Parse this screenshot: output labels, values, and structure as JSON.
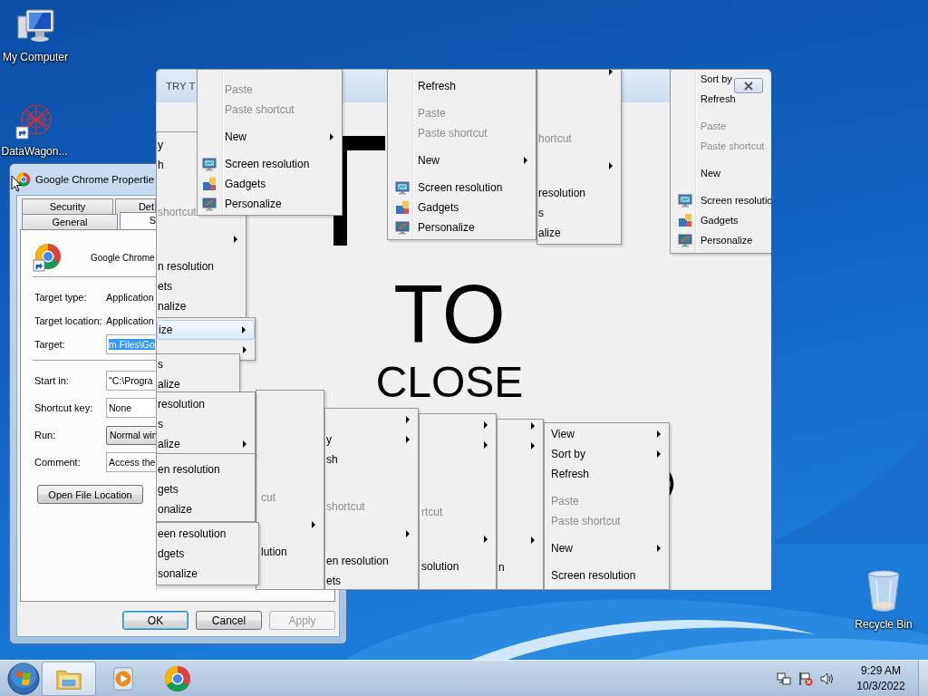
{
  "desktop_icons": [
    {
      "kind": "computer",
      "label": "My Computer"
    },
    {
      "kind": "shortcut",
      "label": "DataWagon..."
    },
    {
      "kind": "bin",
      "label": "Recycle Bin"
    }
  ],
  "properties_dialog": {
    "title": "Google Chrome Propertie",
    "tab_rows": [
      [
        {
          "label": "Security",
          "selected": false
        },
        {
          "label": "Det",
          "selected": false
        }
      ],
      [
        {
          "label": "General",
          "selected": false
        },
        {
          "label": "S",
          "selected": true
        }
      ]
    ],
    "app_name": "Google Chrome",
    "field_groups": [
      [
        {
          "kind": "info",
          "label": "Target type:",
          "value": "Application"
        },
        {
          "kind": "info",
          "label": "Target location:",
          "value": "Application"
        },
        {
          "kind": "input",
          "label": "Target:",
          "value": "m Files\\Go",
          "text_selected": true
        }
      ],
      [
        {
          "kind": "input",
          "label": "Start in:",
          "value": "\"C:\\Progra",
          "text_selected": false
        },
        {
          "kind": "input",
          "label": "Shortcut key:",
          "value": "None",
          "text_selected": false
        },
        {
          "kind": "dropdown",
          "label": "Run:",
          "value": "Normal win"
        },
        {
          "kind": "input",
          "label": "Comment:",
          "value": "Access the",
          "text_selected": false
        }
      ]
    ],
    "action_button": "Open File Location",
    "buttons": [
      {
        "label": "OK",
        "default": true,
        "disabled": false
      },
      {
        "label": "Cancel",
        "default": false,
        "disabled": false
      },
      {
        "label": "Apply",
        "default": false,
        "disabled": true
      }
    ]
  },
  "prank_window": {
    "title": "TRY T",
    "lines": [
      "TO",
      "CLOSE"
    ],
    "menus": [
      {
        "rows": [
          {
            "kind": "item",
            "text": "y",
            "disabled": false,
            "submenu": false
          },
          {
            "kind": "item",
            "text": "h",
            "disabled": false,
            "submenu": false
          },
          {
            "kind": "separator"
          },
          {
            "kind": "blank"
          },
          {
            "kind": "item",
            "text": "shortcut",
            "disabled": true,
            "submenu": false
          },
          {
            "kind": "separator"
          },
          {
            "kind": "item",
            "disabled": false,
            "submenu": true
          },
          {
            "kind": "separator"
          },
          {
            "kind": "item",
            "text": "n resolution",
            "disabled": false,
            "submenu": false
          },
          {
            "kind": "item",
            "text": "ets",
            "disabled": false,
            "submenu": false
          },
          {
            "kind": "item",
            "text": "nalize",
            "disabled": false,
            "submenu": false
          }
        ]
      },
      {
        "rows": [
          {
            "kind": "item",
            "text": "Paste",
            "disabled": true,
            "submenu": false
          },
          {
            "kind": "item",
            "text": "Paste shortcut",
            "disabled": true,
            "submenu": false
          },
          {
            "kind": "separator"
          },
          {
            "kind": "item",
            "text": "New",
            "disabled": false,
            "submenu": true
          },
          {
            "kind": "separator"
          },
          {
            "kind": "icon-item",
            "text": "Screen resolution",
            "disabled": false,
            "submenu": false
          },
          {
            "kind": "icon-item",
            "text": "Gadgets",
            "disabled": false,
            "submenu": false
          },
          {
            "kind": "icon-item",
            "text": "Personalize",
            "disabled": false,
            "submenu": false
          }
        ]
      },
      {
        "rows": [
          {
            "kind": "item",
            "disabled": false,
            "submenu": true
          },
          {
            "kind": "blank"
          },
          {
            "kind": "separator"
          },
          {
            "kind": "blank"
          },
          {
            "kind": "item",
            "text": "hortcut",
            "disabled": true,
            "submenu": false
          },
          {
            "kind": "separator"
          },
          {
            "kind": "item",
            "disabled": false,
            "submenu": true
          },
          {
            "kind": "separator"
          },
          {
            "kind": "item",
            "text": "resolution",
            "disabled": false,
            "submenu": false
          },
          {
            "kind": "item",
            "text": "s",
            "disabled": false,
            "submenu": false
          },
          {
            "kind": "item",
            "text": "alize",
            "disabled": false,
            "submenu": false
          }
        ]
      },
      {
        "rows": [
          {
            "kind": "item",
            "text": "Refresh",
            "disabled": false,
            "submenu": false
          },
          {
            "kind": "separator"
          },
          {
            "kind": "item",
            "text": "Paste",
            "disabled": true,
            "submenu": false
          },
          {
            "kind": "item",
            "text": "Paste shortcut",
            "disabled": true,
            "submenu": false
          },
          {
            "kind": "separator"
          },
          {
            "kind": "item",
            "text": "New",
            "disabled": false,
            "submenu": true
          },
          {
            "kind": "separator"
          },
          {
            "kind": "icon-item",
            "text": "Screen resolution",
            "disabled": false,
            "submenu": false
          },
          {
            "kind": "icon-item",
            "text": "Gadgets",
            "disabled": false,
            "submenu": false
          },
          {
            "kind": "icon-item",
            "text": "Personalize",
            "disabled": false,
            "submenu": false
          }
        ]
      },
      {
        "rows": [
          {
            "kind": "item",
            "text": "Sort by",
            "disabled": false,
            "submenu": false
          },
          {
            "kind": "item",
            "text": "Refresh",
            "disabled": false,
            "submenu": false
          },
          {
            "kind": "separator"
          },
          {
            "kind": "item",
            "text": "Paste",
            "disabled": true,
            "submenu": false
          },
          {
            "kind": "item",
            "text": "Paste shortcut",
            "disabled": true,
            "submenu": false
          },
          {
            "kind": "separator"
          },
          {
            "kind": "item",
            "text": "New",
            "disabled": false,
            "submenu": false
          },
          {
            "kind": "separator"
          },
          {
            "kind": "icon-item",
            "text": "Screen resolutio",
            "disabled": false,
            "submenu": false
          },
          {
            "kind": "icon-item",
            "text": "Gadgets",
            "disabled": false,
            "submenu": false
          },
          {
            "kind": "icon-item",
            "text": "Personalize",
            "disabled": false,
            "submenu": false
          }
        ]
      },
      {
        "rows": [
          {
            "kind": "item",
            "text": "ize",
            "disabled": false,
            "submenu": true,
            "highlighted": true
          },
          {
            "kind": "item",
            "disabled": false,
            "submenu": true,
            "highlighted": false
          }
        ]
      },
      {
        "rows": [
          {
            "kind": "item",
            "text": "s",
            "disabled": false,
            "submenu": false
          },
          {
            "kind": "item",
            "text": "alize",
            "disabled": false,
            "submenu": false
          }
        ]
      },
      {
        "rows": [
          {
            "kind": "item",
            "text": "cut",
            "disabled": true,
            "submenu": false
          },
          {
            "kind": "separator"
          },
          {
            "kind": "item",
            "disabled": false,
            "submenu": true
          },
          {
            "kind": "separator"
          },
          {
            "kind": "item",
            "text": "lution",
            "disabled": false,
            "submenu": false
          }
        ]
      },
      {
        "rows": [
          {
            "kind": "item",
            "text": "resolution",
            "disabled": false,
            "submenu": false
          },
          {
            "kind": "item",
            "text": "s",
            "disabled": false,
            "submenu": false
          },
          {
            "kind": "item",
            "text": "alize",
            "disabled": false,
            "submenu": true
          }
        ]
      },
      {
        "rows": [
          {
            "kind": "item",
            "text": "en resolution",
            "disabled": false,
            "submenu": false
          },
          {
            "kind": "item",
            "text": "gets",
            "disabled": false,
            "submenu": false
          },
          {
            "kind": "item",
            "text": "onalize",
            "disabled": false,
            "submenu": false
          }
        ]
      },
      {
        "rows": [
          {
            "kind": "item",
            "text": "een resolution",
            "disabled": false,
            "submenu": false
          },
          {
            "kind": "item",
            "text": "dgets",
            "disabled": false,
            "submenu": false
          },
          {
            "kind": "item",
            "text": "sonalize",
            "disabled": false,
            "submenu": false
          }
        ]
      },
      {
        "rows": [
          {
            "kind": "item",
            "disabled": false,
            "submenu": true
          },
          {
            "kind": "item",
            "text": "y",
            "disabled": false,
            "submenu": true
          },
          {
            "kind": "item",
            "text": "sh",
            "disabled": false,
            "submenu": false
          },
          {
            "kind": "separator"
          },
          {
            "kind": "blank"
          },
          {
            "kind": "item",
            "text": "shortcut",
            "disabled": true,
            "submenu": false
          },
          {
            "kind": "separator"
          },
          {
            "kind": "item",
            "disabled": false,
            "submenu": true
          },
          {
            "kind": "separator"
          },
          {
            "kind": "item",
            "text": "en resolution",
            "disabled": false,
            "submenu": false
          },
          {
            "kind": "item",
            "text": "ets",
            "disabled": false,
            "submenu": false
          }
        ]
      },
      {
        "rows": [
          {
            "kind": "item",
            "disabled": false,
            "submenu": true
          },
          {
            "kind": "item",
            "disabled": false,
            "submenu": true
          },
          {
            "kind": "blank"
          },
          {
            "kind": "separator"
          },
          {
            "kind": "blank"
          },
          {
            "kind": "item",
            "text": "rtcut",
            "disabled": true,
            "submenu": false
          },
          {
            "kind": "separator"
          },
          {
            "kind": "item",
            "disabled": false,
            "submenu": true
          },
          {
            "kind": "separator"
          },
          {
            "kind": "item",
            "text": "solution",
            "disabled": false,
            "submenu": false
          }
        ]
      },
      {
        "rows": [
          {
            "kind": "item",
            "disabled": false,
            "submenu": true
          },
          {
            "kind": "item",
            "disabled": false,
            "submenu": true
          },
          {
            "kind": "blank"
          },
          {
            "kind": "separator"
          },
          {
            "kind": "blank"
          },
          {
            "kind": "blank"
          },
          {
            "kind": "separator"
          },
          {
            "kind": "item",
            "disabled": false,
            "submenu": true
          },
          {
            "kind": "separator"
          },
          {
            "kind": "item",
            "text": "n",
            "disabled": false,
            "submenu": false
          }
        ]
      },
      {
        "rows": [
          {
            "kind": "item",
            "text": "View",
            "disabled": false,
            "submenu": true
          },
          {
            "kind": "item",
            "text": "Sort by",
            "disabled": false,
            "submenu": true
          },
          {
            "kind": "item",
            "text": "Refresh",
            "disabled": false,
            "submenu": false
          },
          {
            "kind": "separator"
          },
          {
            "kind": "item",
            "text": "Paste",
            "disabled": true,
            "submenu": false
          },
          {
            "kind": "item",
            "text": "Paste shortcut",
            "disabled": true,
            "submenu": false
          },
          {
            "kind": "separator"
          },
          {
            "kind": "item",
            "text": "New",
            "disabled": false,
            "submenu": true
          },
          {
            "kind": "separator"
          },
          {
            "kind": "item",
            "text": "Screen resolution",
            "disabled": false,
            "submenu": false
          }
        ]
      }
    ]
  },
  "taskbar": {
    "apps": [
      {
        "kind": "folder",
        "active": true
      },
      {
        "kind": "player",
        "active": false
      },
      {
        "kind": "browser",
        "active": false
      }
    ],
    "clock": {
      "time": "9:29 AM",
      "date": "10/3/2022"
    }
  }
}
